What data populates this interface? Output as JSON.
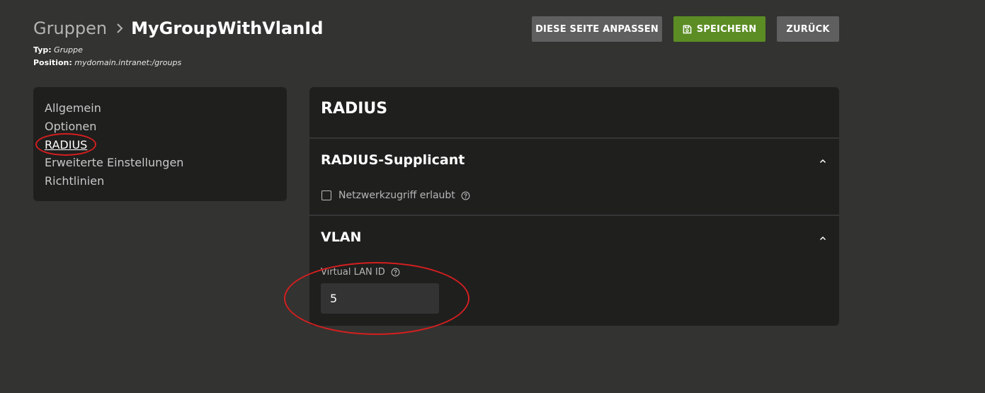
{
  "header": {
    "breadcrumb_parent": "Gruppen",
    "breadcrumb_current": "MyGroupWithVlanId",
    "type_label": "Typ:",
    "type_value": "Gruppe",
    "position_label": "Position:",
    "position_value": "mydomain.intranet:/groups"
  },
  "toolbar": {
    "customize_label": "DIESE SEITE ANPASSEN",
    "save_label": "SPEICHERN",
    "back_label": "ZURÜCK"
  },
  "sidebar": {
    "items": [
      {
        "label": "Allgemein",
        "active": false
      },
      {
        "label": "Optionen",
        "active": false
      },
      {
        "label": "RADIUS",
        "active": true
      },
      {
        "label": "Erweiterte Einstellungen",
        "active": false
      },
      {
        "label": "Richtlinien",
        "active": false
      }
    ]
  },
  "main": {
    "title": "RADIUS",
    "sections": {
      "supplicant": {
        "title": "RADIUS-Supplicant",
        "checkbox_label": "Netzwerkzugriff erlaubt",
        "checked": false
      },
      "vlan": {
        "title": "VLAN",
        "field_label": "Virtual LAN ID",
        "field_value": "5"
      }
    }
  },
  "colors": {
    "background": "#333331",
    "card": "#1f1f1e",
    "save_button": "#5b8d24",
    "neutral_button": "#5f5f5f",
    "annotation": "#d51f1f"
  },
  "icons": [
    "chevron-right-icon",
    "save-icon",
    "chevron-up-icon",
    "help-icon"
  ]
}
